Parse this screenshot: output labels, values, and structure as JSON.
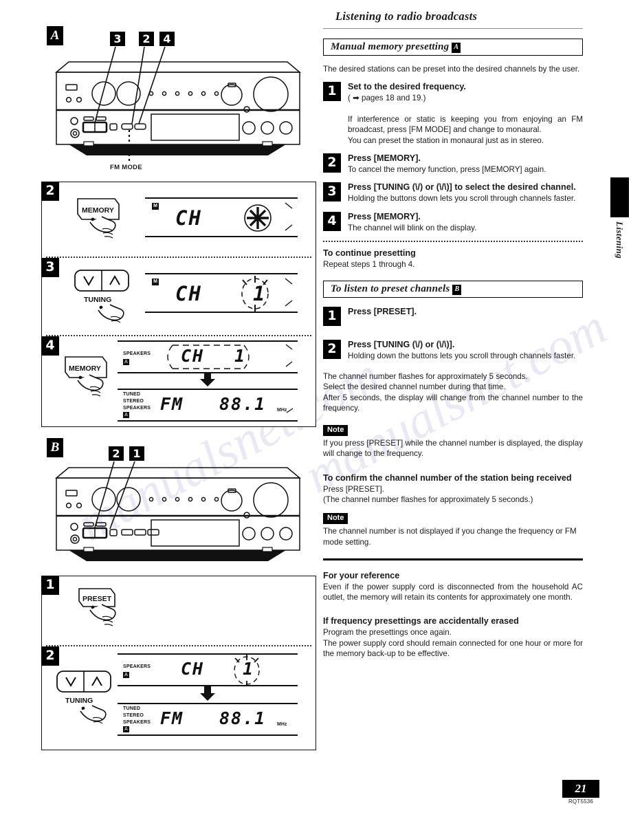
{
  "page": {
    "number": "21",
    "code": "RQT5536",
    "side_tab_label": "Listening"
  },
  "right": {
    "section_title": "Listening to radio broadcasts",
    "bar_a": {
      "text": "Manual memory presetting",
      "marker": "A"
    },
    "intro": "The desired stations can be preset into the desired channels by the user.",
    "steps_a": [
      {
        "num": "1",
        "title": "Set to the desired frequency.",
        "ref": "( ➡ pages 18 and 19.)",
        "body": "If interference or static is keeping you from enjoying an FM broadcast, press [FM MODE] and change to monaural.\nYou can preset the station in monaural just as in stereo."
      },
      {
        "num": "2",
        "title": "Press [MEMORY].",
        "body": "To cancel the memory function, press [MEMORY] again."
      },
      {
        "num": "3",
        "title": "Press [TUNING (\\/) or (\\/\\)] to select the desired channel.",
        "body": "Holding the buttons down lets you scroll through channels faster."
      },
      {
        "num": "4",
        "title": "Press [MEMORY].",
        "body": "The channel will blink on the display."
      }
    ],
    "continue_heading": "To continue presetting",
    "continue_body": "Repeat steps 1 through 4.",
    "bar_b": {
      "text": "To listen to preset channels",
      "marker": "B"
    },
    "steps_b": [
      {
        "num": "1",
        "title": "Press [PRESET]."
      },
      {
        "num": "2",
        "title": "Press [TUNING (\\/) or (\\/\\)].",
        "body": "Holding down the buttons lets you scroll through channels faster."
      }
    ],
    "timing_body": "The channel number flashes for approximately 5 seconds.\nSelect the desired channel number during that time.\nAfter 5 seconds, the display will change from the channel number to the frequency.",
    "note1": {
      "tag": "Note",
      "body": "If you press [PRESET] while the channel number is displayed, the display will change to the frequency."
    },
    "confirm_heading": "To confirm the channel number of the station being received",
    "confirm_body1": "Press [PRESET].",
    "confirm_body2": "(The channel number flashes for approximately 5 seconds.)",
    "note2": {
      "tag": "Note",
      "body": "The channel number is not displayed if you change the frequency or FM mode setting."
    },
    "reference_heading": "For your reference",
    "reference_body": "Even if the power supply cord is disconnected from the household AC outlet, the memory will retain its contents for approximately one month.",
    "erased_heading": "If frequency presettings are accidentally erased",
    "erased_body1": "Program the presettings once again.",
    "erased_body2": "The power supply cord should remain connected for one hour or more for the memory back-up to be effective."
  },
  "left": {
    "fig_a": {
      "label": "A",
      "callouts": [
        "3",
        "2",
        "4"
      ],
      "caption": "FM MODE"
    },
    "fig_b": {
      "label": "B",
      "callouts": [
        "2",
        "1"
      ]
    },
    "steps_a": [
      {
        "num": "2",
        "button": "MEMORY",
        "display": {
          "badge": "M",
          "text": "CH",
          "value": "",
          "flash": "star"
        }
      },
      {
        "num": "3",
        "button_left": "\\/",
        "button_right": "/\\",
        "button_caption": "TUNING",
        "display": {
          "badge": "M",
          "text": "CH",
          "value": "1",
          "flash": "blink"
        }
      },
      {
        "num": "4",
        "button": "MEMORY",
        "display_top": {
          "speakers": "SPEAKERS",
          "speaker_ch": "A",
          "text": "CH",
          "value": "1",
          "flash": "blink-oval"
        },
        "display_bottom": {
          "tuned": "TUNED",
          "stereo": "STEREO",
          "speakers": "SPEAKERS",
          "speaker_ch": "A",
          "band": "FM",
          "freq": "88.1",
          "unit": "MHz"
        }
      }
    ],
    "steps_b": [
      {
        "num": "1",
        "button": "PRESET"
      },
      {
        "num": "2",
        "button_left": "\\/",
        "button_right": "/\\",
        "button_caption": "TUNING",
        "display_top": {
          "speakers": "SPEAKERS",
          "speaker_ch": "A",
          "text": "CH",
          "value": "1",
          "flash": "blink-oval"
        },
        "display_bottom": {
          "tuned": "TUNED",
          "stereo": "STEREO",
          "speakers": "SPEAKERS",
          "speaker_ch": "A",
          "band": "FM",
          "freq": "88.1",
          "unit": "MHz"
        }
      }
    ]
  },
  "watermark": {
    "line1": "manualsnet.com",
    "line2": "manualsnet.com"
  }
}
